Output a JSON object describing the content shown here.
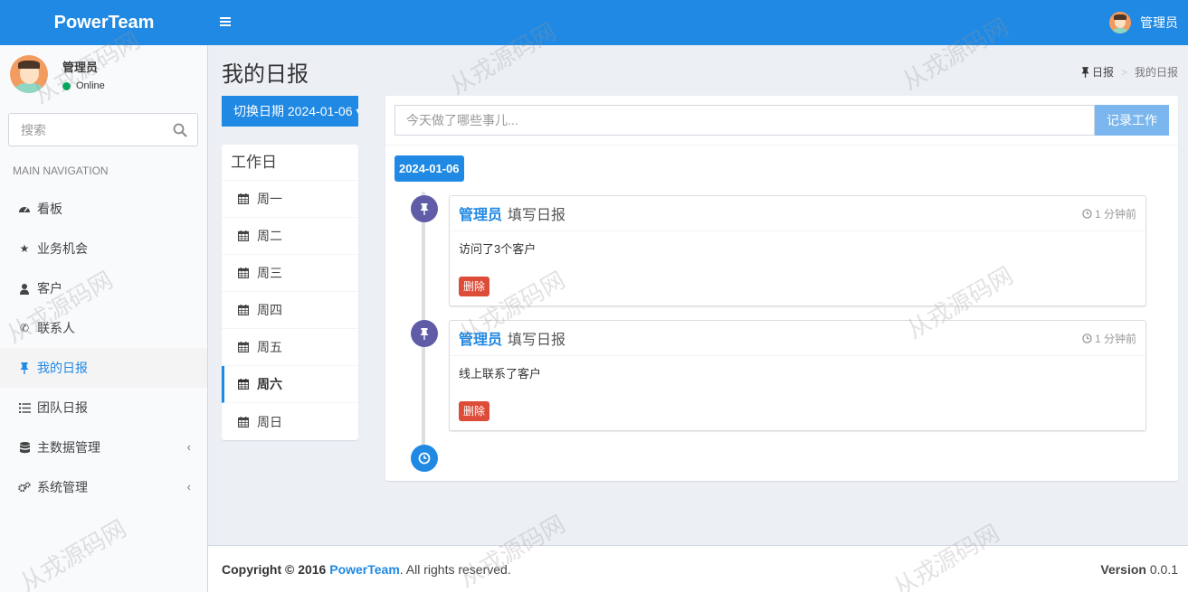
{
  "header": {
    "logo": "PowerTeam",
    "username": "管理员"
  },
  "sidebar": {
    "user": {
      "name": "管理员",
      "status": "Online"
    },
    "search_placeholder": "搜索",
    "nav_header": "MAIN NAVIGATION",
    "items": [
      {
        "label": "看板",
        "icon": "dashboard-icon",
        "active": false,
        "has_caret": false
      },
      {
        "label": "业务机会",
        "icon": "star-icon",
        "active": false,
        "has_caret": false
      },
      {
        "label": "客户",
        "icon": "user-icon",
        "active": false,
        "has_caret": false
      },
      {
        "label": "联系人",
        "icon": "phone-icon",
        "active": false,
        "has_caret": false
      },
      {
        "label": "我的日报",
        "icon": "pin-icon",
        "active": true,
        "has_caret": false
      },
      {
        "label": "团队日报",
        "icon": "list-icon",
        "active": false,
        "has_caret": false
      },
      {
        "label": "主数据管理",
        "icon": "database-icon",
        "active": false,
        "has_caret": true
      },
      {
        "label": "系统管理",
        "icon": "gears-icon",
        "active": false,
        "has_caret": true
      }
    ]
  },
  "content": {
    "title": "我的日报",
    "breadcrumb": {
      "parent": "日报",
      "current": "我的日报"
    },
    "switch_date_label": "切换日期 2024-01-06 ▾",
    "workdays": {
      "title": "工作日",
      "days": [
        "周一",
        "周二",
        "周三",
        "周四",
        "周五",
        "周六",
        "周日"
      ],
      "active_index": 5
    },
    "input_placeholder": "今天做了哪些事儿...",
    "submit_label": "记录工作",
    "date_label": "2024-01-06",
    "entries": [
      {
        "author": "管理员",
        "action": "填写日报",
        "time": "1 分钟前",
        "body": "访问了3个客户",
        "delete_label": "删除"
      },
      {
        "author": "管理员",
        "action": "填写日报",
        "time": "1 分钟前",
        "body": "线上联系了客户",
        "delete_label": "删除"
      }
    ]
  },
  "footer": {
    "copyright_prefix": "Copyright © 2016",
    "brand": "PowerTeam",
    "rights": ". All rights reserved.",
    "version_label": "Version",
    "version_value": "0.0.1"
  },
  "colors": {
    "primary": "#2089e3",
    "purple": "#605ca8",
    "danger": "#dd4b39"
  },
  "watermark": "从戎源码网"
}
